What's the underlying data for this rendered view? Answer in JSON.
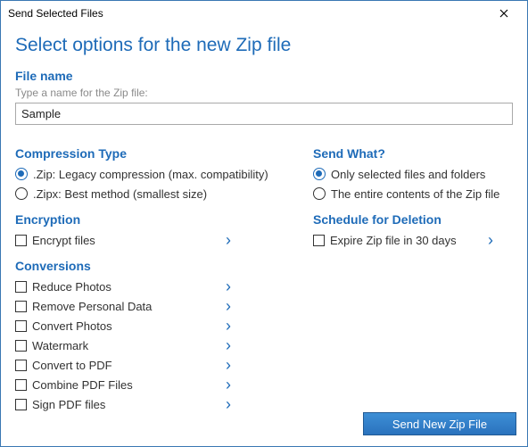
{
  "window": {
    "title": "Send Selected Files"
  },
  "main_title": "Select options for the new Zip file",
  "filename": {
    "label": "File name",
    "hint": "Type a name for the Zip file:",
    "value": "Sample"
  },
  "compression": {
    "label": "Compression Type",
    "options": [
      {
        "label": ".Zip: Legacy compression (max. compatibility)",
        "selected": true
      },
      {
        "label": ".Zipx: Best method (smallest size)",
        "selected": false
      }
    ]
  },
  "encryption": {
    "label": "Encryption",
    "item": "Encrypt files"
  },
  "conversions": {
    "label": "Conversions",
    "items": [
      "Reduce Photos",
      "Remove Personal Data",
      "Convert Photos",
      "Watermark",
      "Convert to PDF",
      "Combine PDF Files",
      "Sign PDF files"
    ]
  },
  "send_what": {
    "label": "Send What?",
    "options": [
      {
        "label": "Only selected files and folders",
        "selected": true
      },
      {
        "label": "The entire contents of the Zip file",
        "selected": false
      }
    ]
  },
  "schedule": {
    "label": "Schedule for Deletion",
    "item": "Expire Zip file in 30 days"
  },
  "submit": "Send New Zip File"
}
